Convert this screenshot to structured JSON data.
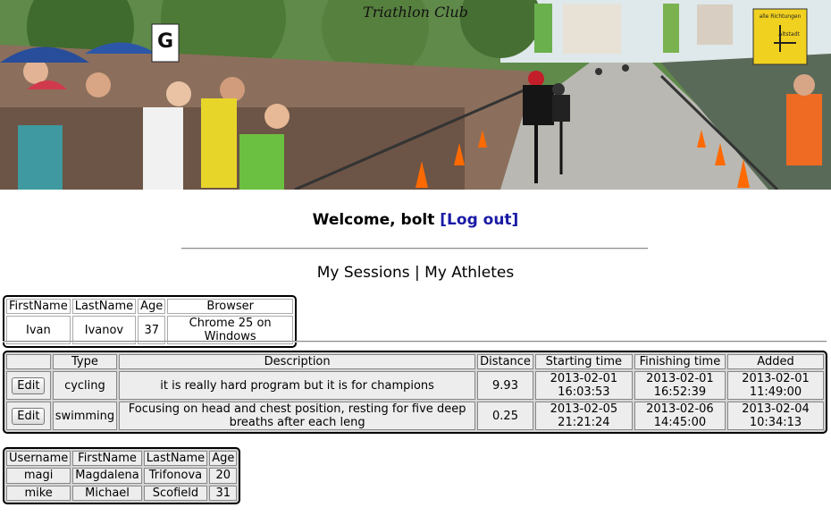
{
  "banner": {
    "title": "Triathlon Club",
    "sign_letter": "G",
    "road_sign_top": "alle Richtungen",
    "road_sign_bottom": "Altstadt"
  },
  "header": {
    "welcome_text": "Welcome, bolt",
    "logout_label": "[Log out]"
  },
  "nav": {
    "my_sessions": "My Sessions",
    "separator": "|",
    "my_athletes": "My Athletes"
  },
  "sessions": {
    "headers": [
      "FirstName",
      "LastName",
      "Age",
      "Browser"
    ],
    "rows": [
      [
        "Ivan",
        "Ivanov",
        "37",
        "Chrome 25 on Windows"
      ]
    ]
  },
  "trainings": {
    "headers": [
      "",
      "Type",
      "Description",
      "Distance",
      "Starting time",
      "Finishing time",
      "Added"
    ],
    "edit_label": "Edit",
    "rows": [
      {
        "type": "cycling",
        "description": "it is really hard program but it is for champions",
        "distance": "9.93",
        "start_date": "2013-02-01",
        "start_time": "16:03:53",
        "finish_date": "2013-02-01",
        "finish_time": "16:52:39",
        "added_date": "2013-02-01",
        "added_time": "11:49:00"
      },
      {
        "type": "swimming",
        "description": "Focusing on head and chest position, resting for five deep breaths after each leng",
        "distance": "0.25",
        "start_date": "2013-02-05",
        "start_time": "21:21:24",
        "finish_date": "2013-02-06",
        "finish_time": "14:45:00",
        "added_date": "2013-02-04",
        "added_time": "10:34:13"
      }
    ]
  },
  "athletes": {
    "headers": [
      "Username",
      "FirstName",
      "LastName",
      "Age"
    ],
    "rows": [
      [
        "magi",
        "Magdalena",
        "Trifonova",
        "20"
      ],
      [
        "mike",
        "Michael",
        "Scofield",
        "31"
      ]
    ]
  }
}
